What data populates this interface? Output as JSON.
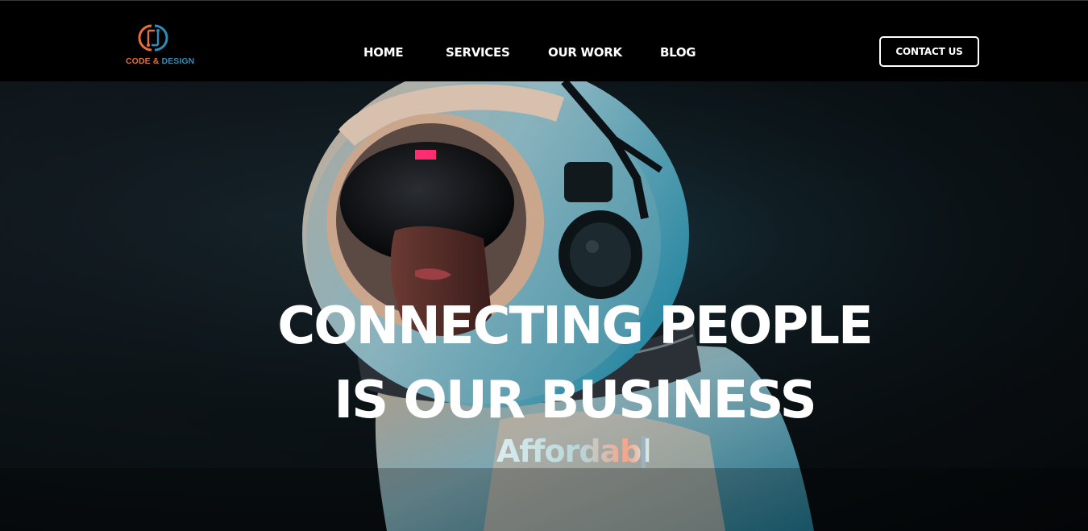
{
  "brand": {
    "logo_word_1": "CODE &",
    "logo_word_2": "DESIGN",
    "colors": {
      "orange": "#e4713a",
      "blue": "#2e8cb8"
    }
  },
  "nav": {
    "items": [
      {
        "label": "HOME"
      },
      {
        "label": "SERVICES"
      },
      {
        "label": "OUR WORK"
      },
      {
        "label": "BLOG"
      }
    ],
    "contact_label": "CONTACT US"
  },
  "hero": {
    "headline_line_1": "CONNECTING PEOPLE",
    "headline_line_2": "IS OUR BUSINESS",
    "typed_text": "Affordabl",
    "image": "astronaut-helmet-portrait"
  }
}
